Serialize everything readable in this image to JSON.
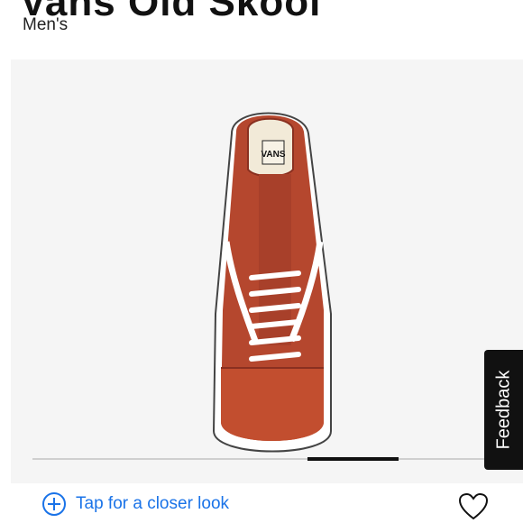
{
  "product": {
    "title": "Vans Old Skool",
    "category": "Men's"
  },
  "gallery": {
    "closer_look_label": "Tap for a closer look",
    "progress": 0.55
  },
  "feedback": {
    "label": "Feedback"
  },
  "icons": {
    "zoom": "plus-circle-icon",
    "favorite": "heart-icon"
  },
  "colors": {
    "accent": "#1a73e8",
    "shoe_suede": "#b5472e",
    "feedback_bg": "#111111"
  }
}
